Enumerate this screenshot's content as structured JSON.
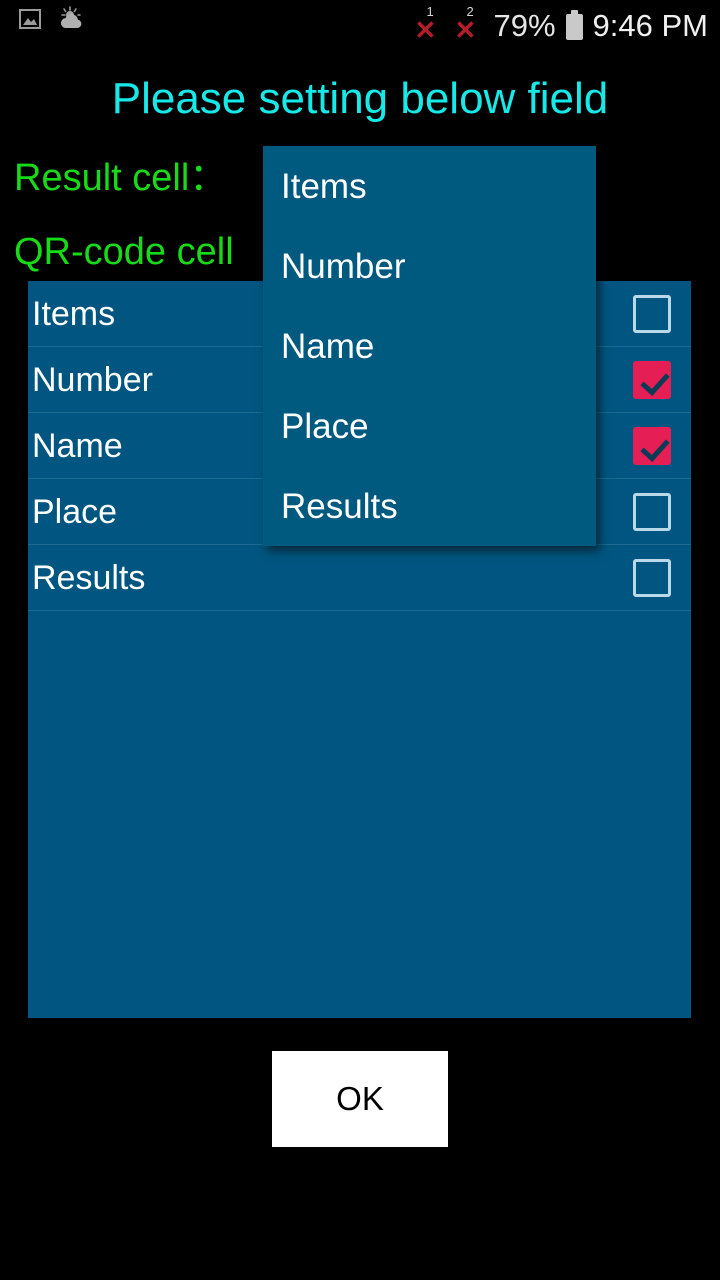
{
  "status_bar": {
    "left_icons": [
      {
        "name": "image-icon",
        "glyph": "photo"
      },
      {
        "name": "weather-partly-cloudy-icon",
        "glyph": "cloud-sun"
      }
    ],
    "sim1_badge": "1",
    "sim1_mark": "✕",
    "sim2_badge": "2",
    "sim2_mark": "✕",
    "battery_percent": "79%",
    "time": "9:46 PM"
  },
  "header": {
    "title": "Please setting below field"
  },
  "form": {
    "result_cell_label": "Result cell：",
    "result_cell_value": "Items",
    "qrcode_cell_label": "QR-code cell",
    "qrcode_cell_value": "Number"
  },
  "list_panel": {
    "rows": [
      {
        "label": "Items",
        "checked": false
      },
      {
        "label": "Number",
        "checked": true
      },
      {
        "label": "Name",
        "checked": true
      },
      {
        "label": "Place",
        "checked": false
      },
      {
        "label": "Results",
        "checked": false
      }
    ]
  },
  "dropdown": {
    "open": true,
    "items": [
      "Items",
      "Number",
      "Name",
      "Place",
      "Results"
    ]
  },
  "footer": {
    "ok_label": "OK"
  },
  "colors": {
    "background": "#000000",
    "panel_blue": "#005680",
    "popup_blue": "#00597F",
    "title_cyan": "#17E9E9",
    "label_green": "#18DB18",
    "checkbox_checked": "#E51F56",
    "checkbox_border": "#b8d9ea",
    "divider": "#1b6b92",
    "button_bg": "#ffffff",
    "button_text": "#000000",
    "status_red": "#b41c28"
  }
}
